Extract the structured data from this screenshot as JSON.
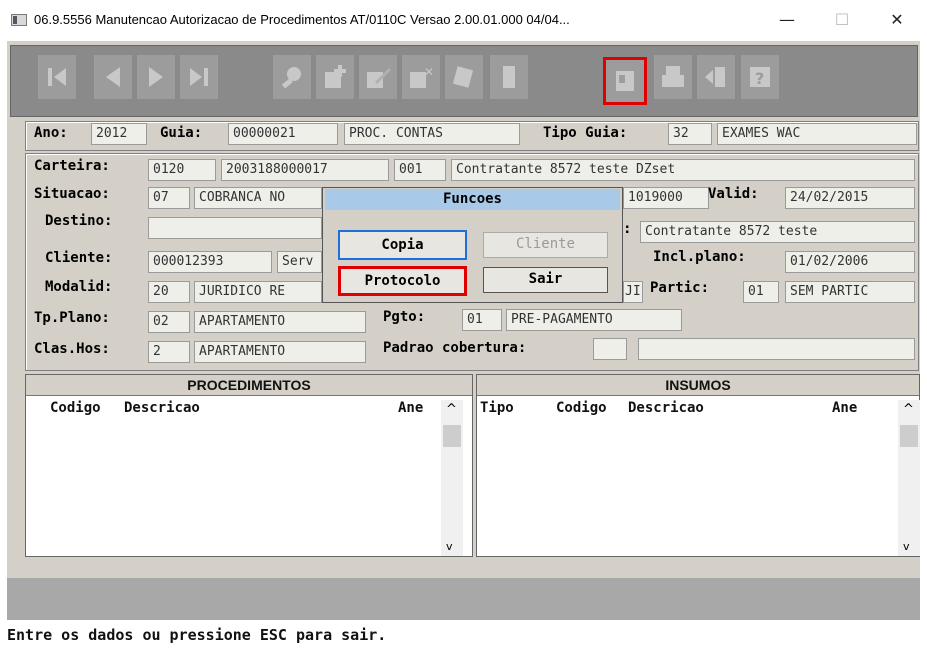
{
  "window": {
    "title": "06.9.5556 Manutencao Autorizacao de Procedimentos AT/0110C Versao 2.00.01.000 04/04...",
    "minimize": "—",
    "maximize": "☐",
    "close": "✕"
  },
  "toolbar": {
    "buttons": [
      "first-icon",
      "previous-icon",
      "next-icon",
      "last-icon",
      "search-icon",
      "add-icon",
      "edit-icon",
      "delete-icon",
      "print-copy-icon",
      "exit-door-icon",
      "functions-icon",
      "printer-icon",
      "import-icon",
      "help-icon"
    ]
  },
  "header": {
    "ano_label": "Ano:",
    "ano": "2012",
    "guia_label": "Guia:",
    "guia": "00000021",
    "guia_desc": "PROC. CONTAS",
    "tipo_guia_label": "Tipo Guia:",
    "tipo_guia": "32",
    "tipo_guia_desc": "EXAMES WAC"
  },
  "form": {
    "carteira_label": "Carteira:",
    "carteira_1": "0120",
    "carteira_2": "2003188000017",
    "carteira_3": "001",
    "carteira_nome": "Contratante 8572 teste DZset",
    "situacao_label": "Situacao:",
    "situacao_cod": "07",
    "situacao_desc": "COBRANCA NO",
    "situacao_num": "1019000",
    "valid_label": "Valid:",
    "valid": "24/02/2015",
    "destino_label": "Destino:",
    "destino_right": "Contratante 8572 teste",
    "cliente_label": "Cliente:",
    "cliente": "000012393",
    "cliente_desc": "Serv",
    "incl_label": "Incl.plano:",
    "incl": "01/02/2006",
    "modalid_label": "Modalid:",
    "modalid": "20",
    "modalid_desc": "JURIDICO RE",
    "modalid_mid": "JI",
    "partic_label": "Partic:",
    "partic": "01",
    "partic_desc": "SEM PARTIC",
    "tpplano_label": "Tp.Plano:",
    "tpplano": "02",
    "tpplano_desc": "APARTAMENTO",
    "pgto_label": "Pgto:",
    "pgto": "01",
    "pgto_desc": "PRE-PAGAMENTO",
    "clashos_label": "Clas.Hos:",
    "clashos": "2",
    "clashos_desc": "APARTAMENTO",
    "padrao_label": "Padrao cobertura:",
    "padrao": "",
    "padrao_desc": ""
  },
  "dialog": {
    "title": "Funcoes",
    "copia": "Copia",
    "cliente": "Cliente",
    "protocolo": "Protocolo",
    "sair": "Sair"
  },
  "procedimentos": {
    "title": "PROCEDIMENTOS",
    "columns": [
      "Codigo",
      "Descricao",
      "Ane"
    ]
  },
  "insumos": {
    "title": "INSUMOS",
    "columns": [
      "Tipo",
      "Codigo",
      "Descricao",
      "Ane"
    ]
  },
  "scroll": {
    "up": "^",
    "down": "v"
  },
  "status": {
    "message": "Entre os dados ou pressione ESC para sair."
  }
}
